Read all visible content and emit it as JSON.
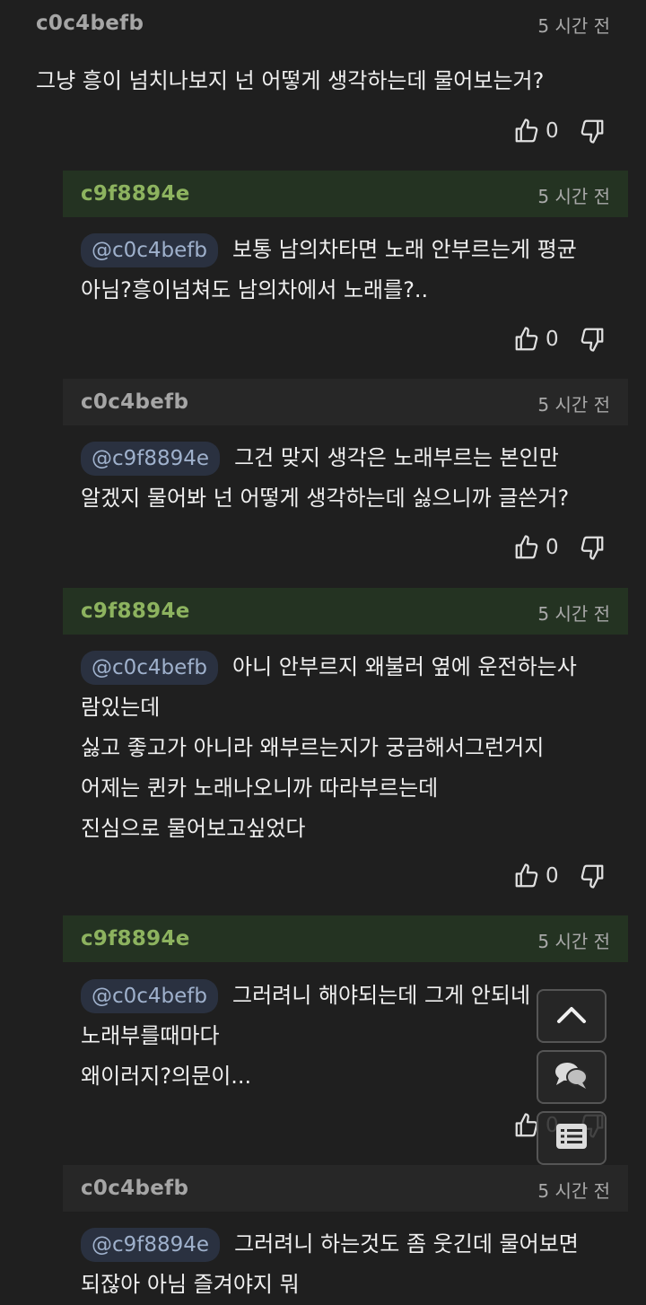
{
  "comments": [
    {
      "author": "c0c4befb",
      "time": "5 시간 전",
      "mention": "",
      "lines": [
        "그냥 흥이 넘치나보지 넌 어떻게 생각하는데 물어보는거?"
      ],
      "likes": "0",
      "header_style": "plain"
    },
    {
      "author": "c9f8894e",
      "time": "5 시간 전",
      "mention": "@c0c4befb",
      "lines": [
        "보통 남의차타면 노래 안부르는게 평균",
        "아님?흥이넘쳐도 남의차에서 노래를?.."
      ],
      "likes": "0",
      "header_style": "green"
    },
    {
      "author": "c0c4befb",
      "time": "5 시간 전",
      "mention": "@c9f8894e",
      "lines": [
        "그건 맞지 생각은 노래부르는 본인만",
        "알겠지 물어봐 넌 어떻게 생각하는데 싫으니까 글쓴거?"
      ],
      "likes": "0",
      "header_style": "grey"
    },
    {
      "author": "c9f8894e",
      "time": "5 시간 전",
      "mention": "@c0c4befb",
      "lines": [
        "아니 안부르지 왜불러 옆에 운전하는사",
        "람있는데",
        "싫고 좋고가 아니라 왜부르는지가 궁금해서그런거지",
        "어제는 퀸카 노래나오니까 따라부르는데",
        "진심으로 물어보고싶었다"
      ],
      "likes": "0",
      "header_style": "green"
    },
    {
      "author": "c9f8894e",
      "time": "5 시간 전",
      "mention": "@c0c4befb",
      "lines": [
        "그러려니 해야되는데 그게 안되네",
        "노래부를때마다",
        "왜이러지?의문이..."
      ],
      "likes": "0",
      "header_style": "green"
    },
    {
      "author": "c0c4befb",
      "time": "5 시간 전",
      "mention": "@c9f8894e",
      "lines": [
        "그러려니 하는것도 좀 웃긴데 물어보면",
        "되잖아 아님 즐겨야지 뭐"
      ],
      "likes": "",
      "header_style": "grey"
    }
  ],
  "floating_buttons": {
    "scroll_top_icon": "chevron-up-icon",
    "comments_icon": "chat-bubbles-icon",
    "list_icon": "list-icon"
  },
  "colors": {
    "background": "#1f1f1f",
    "green_author": "#8db35f",
    "grey_author": "#a6a6a6",
    "mention_text": "#9fb1cc"
  }
}
